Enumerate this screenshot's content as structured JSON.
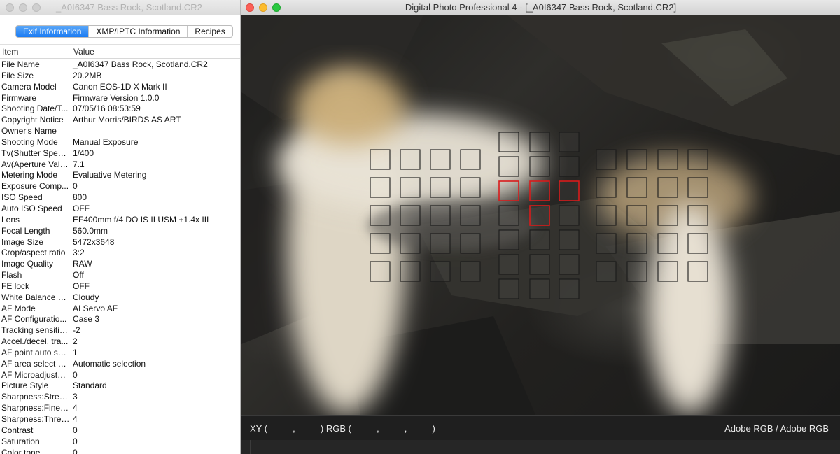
{
  "left_window": {
    "title": "_A0I6347 Bass Rock, Scotland.CR2",
    "tabs": [
      "Exif Information",
      "XMP/IPTC Information",
      "Recipes"
    ],
    "active_tab": "Exif Information",
    "columns": {
      "item": "Item",
      "value": "Value"
    },
    "rows": [
      {
        "k": "File Name",
        "v": "_A0I6347 Bass Rock, Scotland.CR2"
      },
      {
        "k": "File Size",
        "v": "20.2MB"
      },
      {
        "k": "Camera Model",
        "v": "Canon EOS-1D X Mark II"
      },
      {
        "k": "Firmware",
        "v": "Firmware Version 1.0.0"
      },
      {
        "k": "Shooting Date/T...",
        "v": "07/05/16 08:53:59"
      },
      {
        "k": "Copyright Notice",
        "v": "Arthur Morris/BIRDS AS ART"
      },
      {
        "k": "Owner's Name",
        "v": ""
      },
      {
        "k": "Shooting Mode",
        "v": "Manual Exposure"
      },
      {
        "k": "Tv(Shutter Speed)",
        "v": "1/400"
      },
      {
        "k": "Av(Aperture Value)",
        "v": "7.1"
      },
      {
        "k": "Metering Mode",
        "v": "Evaluative Metering"
      },
      {
        "k": "Exposure Comp...",
        "v": "0"
      },
      {
        "k": "ISO Speed",
        "v": "800"
      },
      {
        "k": "Auto ISO Speed",
        "v": "OFF"
      },
      {
        "k": "Lens",
        "v": "EF400mm f/4 DO IS II USM +1.4x III"
      },
      {
        "k": "Focal Length",
        "v": "560.0mm"
      },
      {
        "k": "Image Size",
        "v": "5472x3648"
      },
      {
        "k": "Crop/aspect ratio",
        "v": "3:2"
      },
      {
        "k": "Image Quality",
        "v": "RAW"
      },
      {
        "k": "Flash",
        "v": "Off"
      },
      {
        "k": "FE lock",
        "v": "OFF"
      },
      {
        "k": "White Balance M...",
        "v": "Cloudy"
      },
      {
        "k": "AF Mode",
        "v": "AI Servo AF"
      },
      {
        "k": "AF Configuratio...",
        "v": "Case 3"
      },
      {
        "k": "Tracking sensitivity",
        "v": "-2"
      },
      {
        "k": "Accel./decel. tra...",
        "v": "2"
      },
      {
        "k": "AF point auto sw...",
        "v": "1"
      },
      {
        "k": "AF area select m...",
        "v": "Automatic selection"
      },
      {
        "k": "AF Microadjustm...",
        "v": "0"
      },
      {
        "k": "Picture Style",
        "v": "Standard"
      },
      {
        "k": "Sharpness:Stren...",
        "v": "3"
      },
      {
        "k": "Sharpness:Finen...",
        "v": "4"
      },
      {
        "k": "Sharpness:Thres...",
        "v": "4"
      },
      {
        "k": "Contrast",
        "v": "0"
      },
      {
        "k": "Saturation",
        "v": "0"
      },
      {
        "k": "Color tone",
        "v": "0"
      }
    ]
  },
  "right_window": {
    "title": "Digital Photo Professional 4 - [_A0I6347 Bass Rock, Scotland.CR2]",
    "status_xy": "XY (          ,          ) RGB (          ,          ,          )",
    "color_profile": "Adobe RGB / Adobe RGB",
    "colors": {
      "af_point": "#1a1a1a",
      "af_point_active": "#d91b1b",
      "bird_white": "#e9e3d6"
    }
  }
}
